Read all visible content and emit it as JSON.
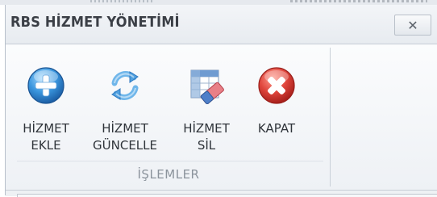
{
  "window": {
    "title": "RBS HİZMET YÖNETİMİ",
    "close_label": "✕"
  },
  "ribbon": {
    "buttons": [
      {
        "label": "HİZMET\nEKLE",
        "icon": "add-icon"
      },
      {
        "label": "HİZMET\nGÜNCELLE",
        "icon": "refresh-icon"
      },
      {
        "label": "HİZMET\nSİL",
        "icon": "eraser-icon"
      },
      {
        "label": "KAPAT",
        "icon": "close-circle-icon"
      }
    ],
    "group_label": "İŞLEMLER"
  },
  "colors": {
    "accent_blue": "#2f86d0",
    "close_red": "#d2322d",
    "green": "#3faa3c"
  }
}
